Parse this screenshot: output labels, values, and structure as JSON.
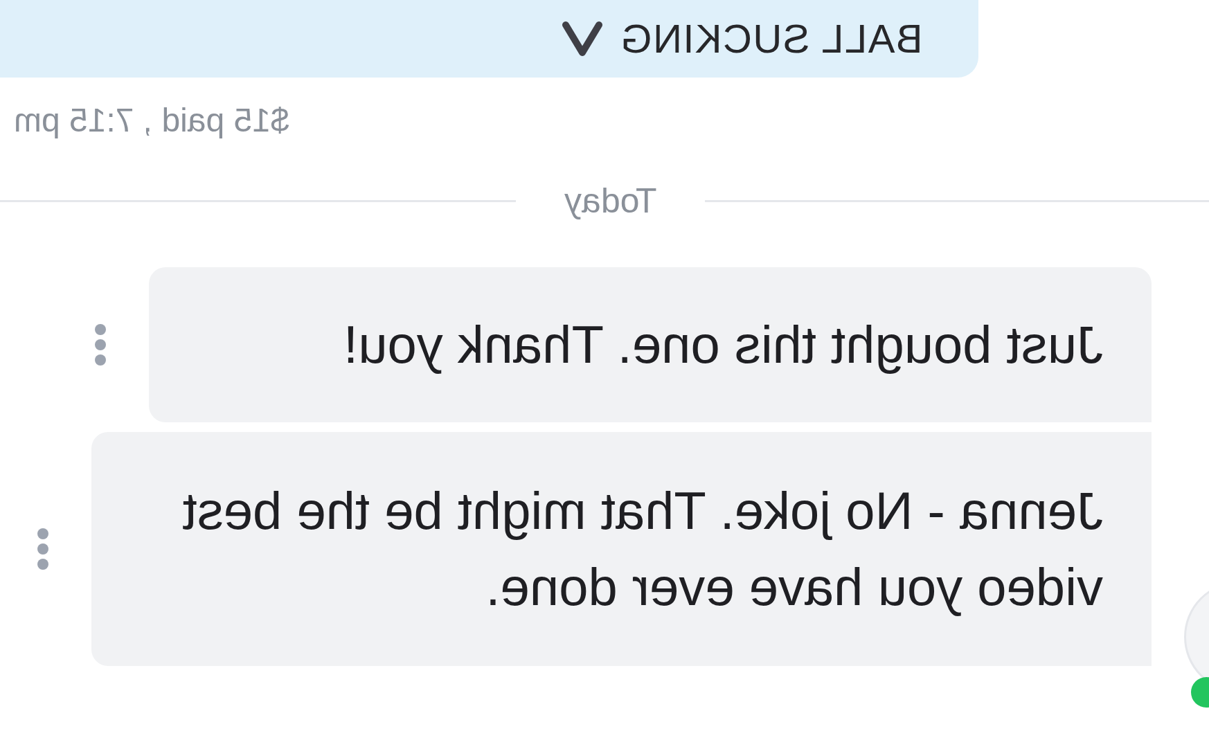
{
  "paid_message": {
    "title": "BALL SUCKING",
    "note": "$15 paid , 7:15 pm"
  },
  "date_divider": "Today",
  "messages": [
    {
      "text": "Just bought this one. Thank you!"
    },
    {
      "text": "Jenna - No joke. That might be the best video you have ever done."
    }
  ]
}
